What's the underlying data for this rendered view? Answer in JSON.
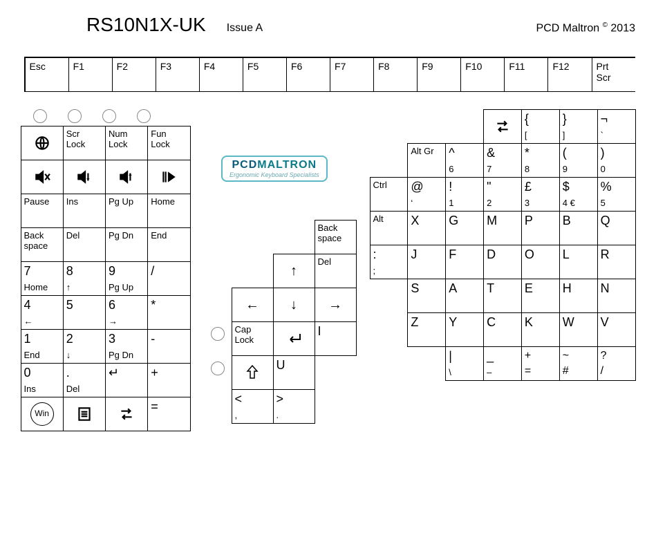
{
  "header": {
    "title": "RS10N1X-UK",
    "issue": "Issue A",
    "copyright_name": "PCD Maltron",
    "copyright_year": "2013"
  },
  "logo": {
    "line1_a": "PCD",
    "line1_b": "MALTRON",
    "line2": "Ergonomic Keyboard Specialists"
  },
  "frow": [
    "Esc",
    "F1",
    "F2",
    "F3",
    "F4",
    "F5",
    "F6",
    "F7",
    "F8",
    "F9",
    "F10",
    "F11",
    "F12",
    "Prt\nScr"
  ],
  "left": {
    "r1": [
      "globe-icon",
      "Scr\nLock",
      "Num\nLock",
      "Fun\nLock"
    ],
    "r2": [
      "mute-icon",
      "vol-down-icon",
      "vol-up-icon",
      "play-icon"
    ],
    "r3": [
      "Pause",
      "Ins",
      "Pg Up",
      "Home"
    ],
    "r4": [
      "Back\nspace",
      "Del",
      "Pg Dn",
      "End"
    ],
    "r5": [
      [
        "7",
        "Home"
      ],
      [
        "8",
        "↑"
      ],
      [
        "9",
        "Pg Up"
      ],
      [
        "/",
        ""
      ]
    ],
    "r6": [
      [
        "4",
        "←"
      ],
      [
        "5",
        ""
      ],
      [
        "6",
        "→"
      ],
      [
        "*",
        ""
      ]
    ],
    "r7": [
      [
        "1",
        "End"
      ],
      [
        "2",
        "↓"
      ],
      [
        "3",
        "Pg Dn"
      ],
      [
        "-",
        ""
      ]
    ],
    "r8": [
      [
        "0",
        "Ins"
      ],
      [
        ".",
        "Del"
      ],
      [
        "↵",
        ""
      ],
      [
        "+",
        ""
      ]
    ],
    "r9": [
      "Win",
      "menu-icon",
      "tab-icon",
      "="
    ]
  },
  "mid": {
    "r1": [
      "",
      "",
      "Back\nspace"
    ],
    "r2": [
      "",
      "↑",
      "Del"
    ],
    "r3": [
      "←",
      "↓",
      "→"
    ],
    "r4": [
      "Cap\nLock",
      "↵",
      "I"
    ],
    "r5": [
      "⇧",
      "U",
      ""
    ],
    "r6": [
      [
        "<",
        ","
      ],
      [
        ">",
        "."
      ],
      ""
    ]
  },
  "right": {
    "r1": [
      "",
      "",
      "",
      "tab-icon",
      [
        "{",
        "["
      ],
      [
        "}",
        "]"
      ],
      [
        "¬",
        "`"
      ]
    ],
    "r2": [
      "",
      "Alt Gr",
      [
        "^",
        "6"
      ],
      [
        "&",
        "7"
      ],
      [
        "*",
        "8"
      ],
      [
        "(",
        "9"
      ],
      [
        ")",
        "0"
      ]
    ],
    "r3": [
      "Ctrl",
      [
        "@",
        "‘"
      ],
      [
        "!",
        "1"
      ],
      [
        "\"",
        "2"
      ],
      [
        "£",
        "3"
      ],
      [
        "$",
        "4  €"
      ],
      [
        "%",
        "5"
      ]
    ],
    "r4": [
      "Alt",
      "X",
      "G",
      "M",
      "P",
      "B",
      "Q"
    ],
    "r5": [
      [
        ":",
        ";"
      ],
      "J",
      "F",
      "D",
      "O",
      "L",
      "R"
    ],
    "r6": [
      "",
      "S",
      "A",
      "T",
      "E",
      "H",
      "N"
    ],
    "r7": [
      "",
      "Z",
      "Y",
      "C",
      "K",
      "W",
      "V"
    ],
    "r8": [
      "",
      "",
      "",
      [
        "|",
        "\\"
      ],
      [
        "_",
        "–"
      ],
      [
        "+\n=",
        "~\n#"
      ],
      [
        "?",
        "/"
      ]
    ],
    "r8b": [
      "",
      "",
      "",
      [
        "|",
        "\\"
      ],
      [
        "_",
        "–"
      ],
      [
        "+",
        "="
      ],
      [
        "~",
        "#"
      ],
      [
        "?",
        "/"
      ]
    ]
  }
}
